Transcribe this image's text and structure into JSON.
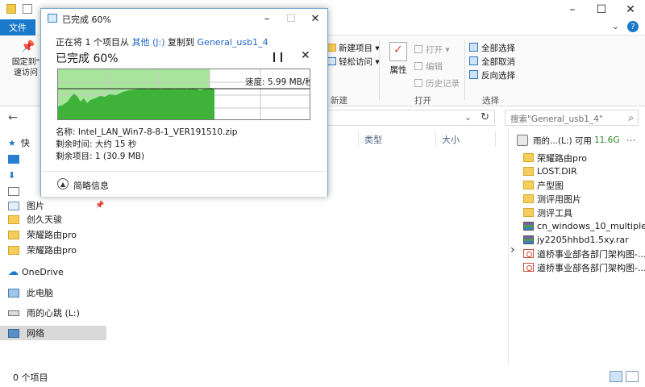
{
  "explorer": {
    "file_tab": "文件",
    "ribbon": {
      "pin_label": "固定到\"快速访问\"",
      "pin_line1": "固定到\"",
      "pin_line2": "速访问",
      "new_item": "新建项目",
      "easy_access": "轻松访问",
      "new_group": "新建",
      "properties": "属性",
      "open": "打开",
      "edit": "编辑",
      "history": "历史记录",
      "open_group": "打开",
      "select_all": "全部选择",
      "select_none": "全部取消",
      "invert": "反向选择",
      "select_group": "选择"
    },
    "search_placeholder": "搜索\"General_usb1_4\"",
    "columns": {
      "type": "类型",
      "size": "大小"
    },
    "nav": {
      "quick_access": "快",
      "pictures": "图片",
      "folder1": "创久天骏",
      "folder2": "荣耀路由pro",
      "folder3": "荣耀路由pro",
      "onedrive": "OneDrive",
      "this_pc": "此电脑",
      "drive_l": "雨的心跳 (L:)",
      "network": "网络"
    },
    "preview": {
      "drive_caption": "雨的...(L:) 可用",
      "free_space": "11.6G",
      "items": [
        {
          "name": "荣耀路由pro",
          "icon": "folder-icon"
        },
        {
          "name": "LOST.DIR",
          "icon": "folder-icon"
        },
        {
          "name": "产型图",
          "icon": "folder-icon"
        },
        {
          "name": "测评用图片",
          "icon": "folder-icon"
        },
        {
          "name": "测评工具",
          "icon": "folder-icon"
        },
        {
          "name": "cn_windows_10_multiple...",
          "icon": "archive-icon"
        },
        {
          "name": "jy2205hhbd1.5xy.rar",
          "icon": "archive-icon"
        },
        {
          "name": "道桥事业部各部门架构图-...",
          "icon": "document-icon"
        },
        {
          "name": "道桥事业部各部门架构图-...",
          "icon": "document-icon"
        }
      ]
    },
    "status": "0 个项目"
  },
  "dialog": {
    "title": "已完成 60%",
    "line_prefix": "正在将 1 个项目从",
    "source": "其他 (J:)",
    "line_mid": "复制到",
    "destination": "General_usb1_4",
    "percent_text": "已完成 60%",
    "speed": "速度: 5.99 MB/秒",
    "name_line": "名称: Intel_LAN_Win7-8-8-1_VER191510.zip",
    "time_line": "剩余时间: 大约 15 秒",
    "items_line": "剩余项目: 1 (30.9 MB)",
    "less_details": "简略信息",
    "progress": 0.6
  }
}
